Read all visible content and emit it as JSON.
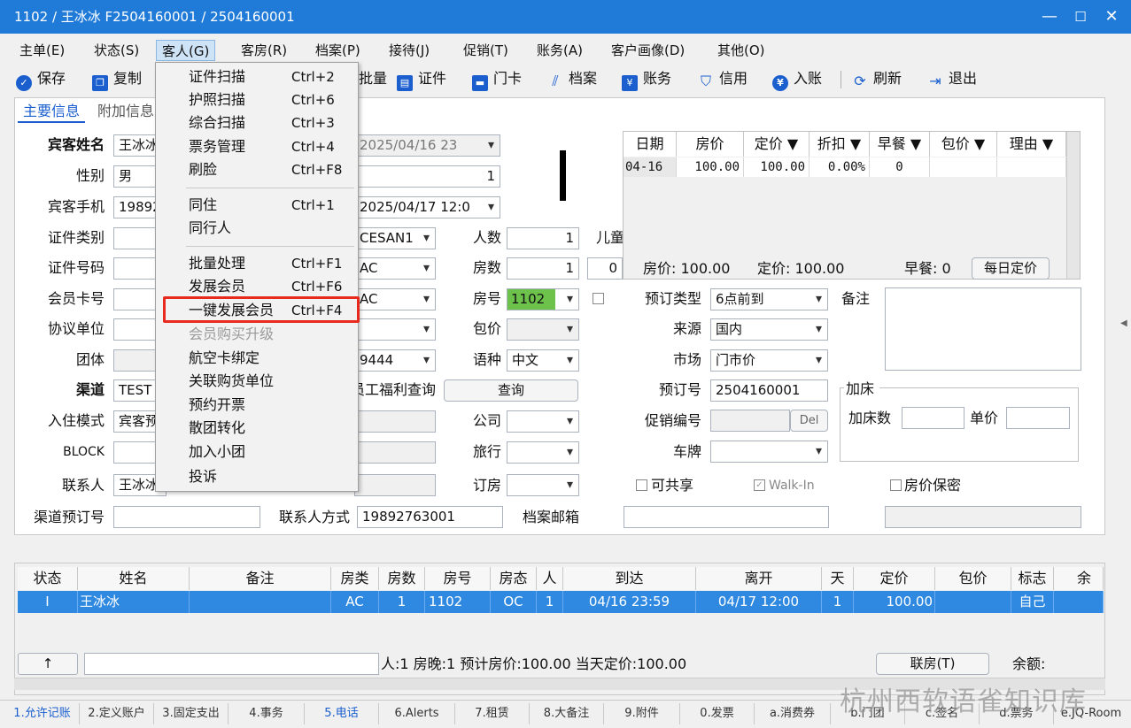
{
  "window": {
    "title": "1102 / 王冰冰  F2504160001 / 2504160001",
    "min": "—",
    "max": "☐",
    "close": "✕"
  },
  "menubar": [
    "主单(E)",
    "状态(S)",
    "客人(G)",
    "客房(R)",
    "档案(P)",
    "接待(J)",
    "促销(T)",
    "账务(A)",
    "客户画像(D)",
    "其他(O)"
  ],
  "toolbar": {
    "save": "保存",
    "copy": "复制",
    "batch": "批量",
    "doc": "证件",
    "card": "门卡",
    "profile": "档案",
    "account": "账务",
    "credit": "信用",
    "post": "入账",
    "refresh": "刷新",
    "exit": "退出"
  },
  "tabs": {
    "main": "主要信息",
    "extra": "附加信息"
  },
  "form": {
    "guest_name_label": "宾客姓名",
    "guest_name": "王冰冰",
    "gender_label": "性别",
    "gender": "男",
    "phone_label": "宾客手机",
    "phone": "19892763001",
    "idtype_label": "证件类别",
    "idno_label": "证件号码",
    "member_label": "会员卡号",
    "agreement_label": "协议单位",
    "group_label": "团体",
    "channel_label": "渠道",
    "channel": "TEST",
    "mode_label": "入住模式",
    "mode": "宾客预订",
    "block_label": "BLOCK",
    "contact_label": "联系人",
    "contact": "王冰冰",
    "channel_order_label": "渠道预订号",
    "contact_method_label": "联系人方式",
    "contact_method": "19892763001",
    "email_label": "档案邮箱",
    "arrive": "2025/04/16 23",
    "nights": "1",
    "depart": "2025/04/17 12:0",
    "rate_code": "CESAN1",
    "room_type": "AC",
    "room_type2": "AC",
    "staff_query_label": "员工福利查询",
    "staff_query_suffix": "9444",
    "query_btn": "查询",
    "persons_label": "人数",
    "persons": "1",
    "child_label": "儿童",
    "rooms_label": "房数",
    "rooms": "1",
    "extra_zero": "0",
    "room_no_label": "房号",
    "room_no": "1102",
    "package_label": "包价",
    "lang_label": "语种",
    "lang": "中文",
    "company_label": "公司",
    "travel_label": "旅行",
    "book_label": "订房",
    "booking_type_label": "预订类型",
    "booking_type": "6点前到",
    "source_label": "来源",
    "source": "国内",
    "market_label": "市场",
    "market": "门市价",
    "booking_no_label": "预订号",
    "booking_no": "2504160001",
    "promo_label": "促销编号",
    "del_btn": "Del",
    "plate_label": "车牌",
    "remark_label": "备注",
    "share_label": "可共享",
    "walkin_label": "Walk-In",
    "rate_secret_label": "房价保密",
    "extra_bed_group": "加床",
    "extra_bed_count_label": "加床数",
    "extra_bed_price_label": "单价",
    "summary_rate": "房价: 100.00",
    "summary_fixed": "定价: 100.00",
    "summary_breakfast": "早餐: 0",
    "daily_rate_btn": "每日定价"
  },
  "rate_grid": {
    "headers": [
      "日期",
      "房价",
      "定价 ▼",
      "折扣 ▼",
      "早餐 ▼",
      "包价 ▼",
      "理由 ▼"
    ],
    "row": [
      "04-16",
      "100.00",
      "100.00",
      "0.00%",
      "0",
      "",
      ""
    ]
  },
  "list": {
    "headers": [
      "状态",
      "姓名",
      "备注",
      "房类",
      "房数",
      "房号",
      "房态",
      "人",
      "到达",
      "离开",
      "天",
      "定价",
      "包价",
      "标志",
      "余额"
    ],
    "row": [
      "I",
      "王冰冰",
      "",
      "AC",
      "1",
      "1102",
      "OC",
      "1",
      "04/16 23:59",
      "04/17 12:00",
      "1",
      "100.00",
      "",
      "自己",
      ""
    ],
    "footer_up": "↑",
    "footer_summary": "人:1  房晚:1  预计房价:100.00  当天定价:100.00",
    "linkroom_btn": "联房(T)",
    "balance_label": "余额:"
  },
  "statusbar": [
    "1.允许记账",
    "2.定义账户",
    "3.固定支出",
    "4.事务",
    "5.电话",
    "6.Alerts",
    "7.租赁",
    "8.大备注",
    "9.附件",
    "0.发票",
    "a.消费券",
    "b.门团",
    "c.签名",
    "d.票务",
    "e.JQ-Room"
  ],
  "dropdown": {
    "items": [
      {
        "label": "证件扫描",
        "key": "Ctrl+2"
      },
      {
        "label": "护照扫描",
        "key": "Ctrl+6"
      },
      {
        "label": "综合扫描",
        "key": "Ctrl+3"
      },
      {
        "label": "票务管理",
        "key": "Ctrl+4"
      },
      {
        "label": "刷脸",
        "key": "Ctrl+F8"
      },
      {
        "label": "同住",
        "key": "Ctrl+1"
      },
      {
        "label": "同行人",
        "key": ""
      },
      {
        "label": "批量处理",
        "key": "Ctrl+F1"
      },
      {
        "label": "发展会员",
        "key": "Ctrl+F6"
      },
      {
        "label": "一键发展会员",
        "key": "Ctrl+F4"
      },
      {
        "label": "会员购买升级",
        "key": ""
      },
      {
        "label": "航空卡绑定",
        "key": ""
      },
      {
        "label": "关联购货单位",
        "key": ""
      },
      {
        "label": "预约开票",
        "key": ""
      },
      {
        "label": "散团转化",
        "key": ""
      },
      {
        "label": "加入小团",
        "key": ""
      },
      {
        "label": "投诉",
        "key": ""
      }
    ]
  },
  "watermark": "杭州西软语雀知识库",
  "colors": {
    "title_bar": "#1f7ad8",
    "selected_row": "#2f89e0",
    "room_no_bg": "#6cc24a",
    "highlight": "#e82a1e"
  }
}
